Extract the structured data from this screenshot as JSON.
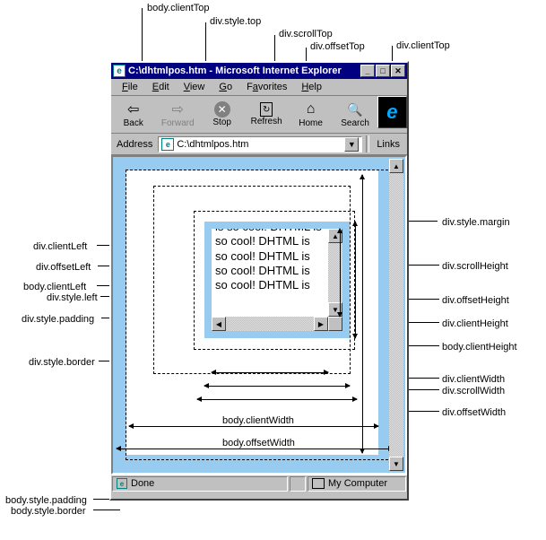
{
  "window": {
    "title": "C:\\dhtmlpos.htm - Microsoft Internet Explorer"
  },
  "menu": {
    "file": "File",
    "edit": "Edit",
    "view": "View",
    "go": "Go",
    "favorites": "Favorites",
    "help": "Help"
  },
  "toolbar": {
    "back": "Back",
    "forward": "Forward",
    "stop": "Stop",
    "refresh": "Refresh",
    "home": "Home",
    "search": "Search"
  },
  "address": {
    "label": "Address",
    "value": "C:\\dhtmlpos.htm",
    "links": "Links"
  },
  "status": {
    "done": "Done",
    "zone": "My Computer"
  },
  "div_text": "is so cool! DHTML is so cool! DHTML is so cool! DHTML is so cool! DHTML is so cool! DHTML is",
  "callouts": {
    "top": {
      "body_clientTop": "body.clientTop",
      "div_style_top": "div.style.top",
      "div_scrollTop": "div.scrollTop",
      "div_offsetTop": "div.offsetTop",
      "div_clientTop": "div.clientTop"
    },
    "left": {
      "div_clientLeft": "div.clientLeft",
      "div_offsetLeft": "div.offsetLeft",
      "body_clientLeft": "body.clientLeft",
      "div_style_left": "div.style.left",
      "div_style_padding": "div.style.padding",
      "div_style_border": "div.style.border",
      "body_style_padding": "body.style.padding",
      "body_style_border": "body.style.border"
    },
    "right": {
      "div_style_margin": "div.style.margin",
      "div_scrollHeight": "div.scrollHeight",
      "div_offsetHeight": "div.offsetHeight",
      "div_clientHeight": "div.clientHeight",
      "body_clientHeight": "body.clientHeight",
      "div_clientWidth": "div.clientWidth",
      "div_scrollWidth": "div.scrollWidth",
      "div_offsetWidth": "div.offsetWidth"
    }
  },
  "measures": {
    "body_clientWidth": "body.clientWidth",
    "body_offsetWidth": "body.offsetWidth"
  }
}
